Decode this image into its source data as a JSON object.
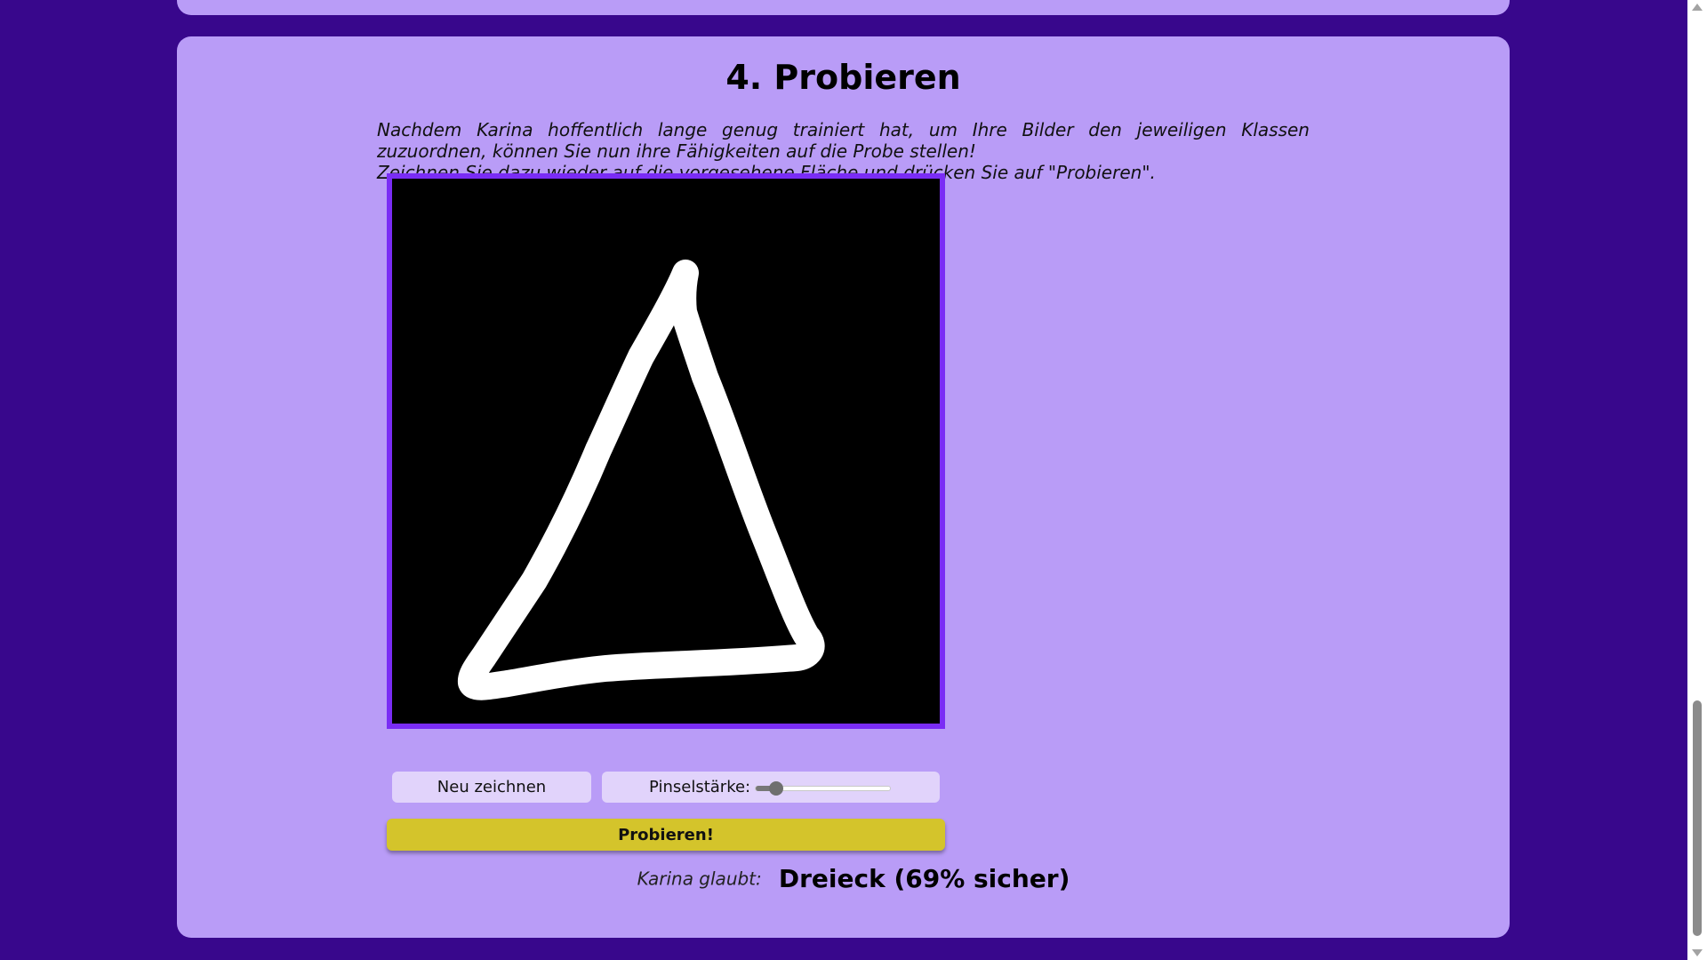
{
  "section": {
    "title": "4. Probieren",
    "instructions": [
      "Nachdem Karina hoffentlich lange genug trainiert hat, um Ihre Bilder den jeweiligen Klassen zuzuordnen, können Sie nun ihre Fähigkeiten auf die Probe stellen!",
      "Zeichnen Sie dazu wieder auf die vorgesehene Fläche und drücken Sie auf \"Probieren\"."
    ]
  },
  "canvas": {
    "background": "#000000",
    "stroke_color": "#ffffff",
    "drawing": "triangle"
  },
  "controls": {
    "clear_label": "Neu zeichnen",
    "brush_label": "Pinselstärke:",
    "brush_size_fraction": 0.15
  },
  "try_button": {
    "label": "Probieren!"
  },
  "result": {
    "label": "Karina glaubt:",
    "prediction": "Dreieck (69% sicher)"
  },
  "colors": {
    "page_background": "#38078c",
    "card_background": "#b99cf7",
    "canvas_border": "#7a2cf5",
    "button_light": "#e1d3fb",
    "try_button": "#d4c42b"
  }
}
